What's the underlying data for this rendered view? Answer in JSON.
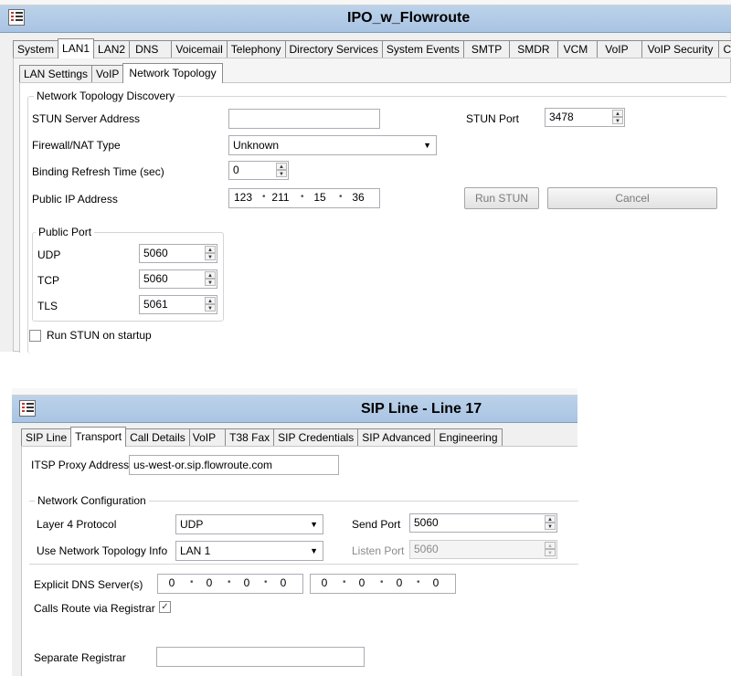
{
  "window1": {
    "title": "IPO_w_Flowroute",
    "tabs": [
      "System",
      "LAN1",
      "LAN2",
      "DNS",
      "Voicemail",
      "Telephony",
      "Directory Services",
      "System Events",
      "SMTP",
      "SMDR",
      "VCM",
      "VoIP",
      "VoIP Security",
      "C"
    ],
    "subtabs": [
      "LAN Settings",
      "VoIP",
      "Network Topology"
    ],
    "group_title": "Network Topology Discovery",
    "stun_server_label": "STUN Server Address",
    "stun_server_value": "",
    "stun_port_label": "STUN Port",
    "stun_port_value": "3478",
    "firewall_label": "Firewall/NAT Type",
    "firewall_value": "Unknown",
    "binding_label": "Binding Refresh Time (sec)",
    "binding_value": "0",
    "public_ip_label": "Public IP Address",
    "public_ip": [
      "123",
      "211",
      "15",
      "36"
    ],
    "run_stun_button": "Run STUN",
    "cancel_button": "Cancel",
    "public_port_title": "Public Port",
    "udp_label": "UDP",
    "udp_value": "5060",
    "tcp_label": "TCP",
    "tcp_value": "5060",
    "tls_label": "TLS",
    "tls_value": "5061",
    "run_on_startup_label": "Run STUN on startup",
    "run_on_startup_checked": false
  },
  "window2": {
    "title": "SIP Line - Line 17",
    "tabs": [
      "SIP Line",
      "Transport",
      "Call Details",
      "VoIP",
      "T38 Fax",
      "SIP Credentials",
      "SIP Advanced",
      "Engineering"
    ],
    "itsp_label": "ITSP Proxy Address",
    "itsp_value": "us-west-or.sip.flowroute.com",
    "network_config_title": "Network Configuration",
    "layer4_label": "Layer 4 Protocol",
    "layer4_value": "UDP",
    "send_port_label": "Send Port",
    "send_port_value": "5060",
    "topology_label": "Use Network Topology Info",
    "topology_value": "LAN 1",
    "listen_port_label": "Listen Port",
    "listen_port_value": "5060",
    "dns_label": "Explicit DNS Server(s)",
    "dns1": [
      "0",
      "0",
      "0",
      "0"
    ],
    "dns2": [
      "0",
      "0",
      "0",
      "0"
    ],
    "calls_route_label": "Calls Route via Registrar",
    "calls_route_checked": true,
    "separate_registrar_label": "Separate Registrar",
    "separate_registrar_value": ""
  },
  "icons": {
    "menu": "list-menu-icon",
    "dropdown": "chevron-down-icon",
    "spin": "spin-up-down-icon",
    "check": "checkmark-icon"
  },
  "colors": {
    "titlebar": "#a9c4e3",
    "tab_bg": "#f0f0f0",
    "border": "#8c8c8c"
  }
}
